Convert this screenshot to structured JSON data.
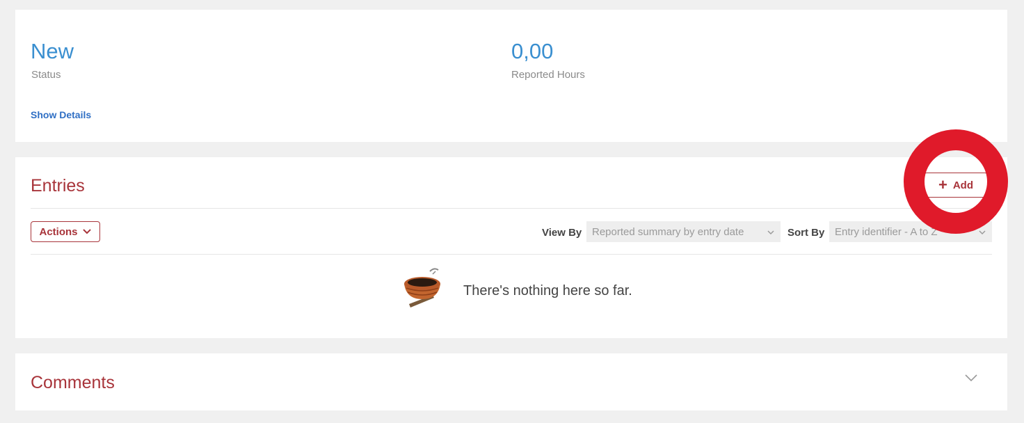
{
  "summary": {
    "status_value": "New",
    "status_label": "Status",
    "hours_value": "0,00",
    "hours_label": "Reported Hours",
    "show_details": "Show Details"
  },
  "entries": {
    "title": "Entries",
    "add_label": "Add",
    "actions_label": "Actions",
    "view_by_label": "View By",
    "view_by_value": "Reported summary by entry date",
    "sort_by_label": "Sort By",
    "sort_by_value": "Entry identifier - A to Z",
    "empty_message": "There's nothing here so far."
  },
  "comments": {
    "title": "Comments"
  },
  "icons": {
    "add": "plus-icon",
    "actions": "chevron-down-icon",
    "select": "chevron-down-icon",
    "empty": "empty-nest-icon",
    "comments_toggle": "chevron-down-icon"
  },
  "colors": {
    "accent_blue": "#3a8fd0",
    "link_blue": "#2f6fc4",
    "brand_red": "#a8343a",
    "highlight_red": "#e01a2a",
    "background": "#f0f0f0"
  }
}
